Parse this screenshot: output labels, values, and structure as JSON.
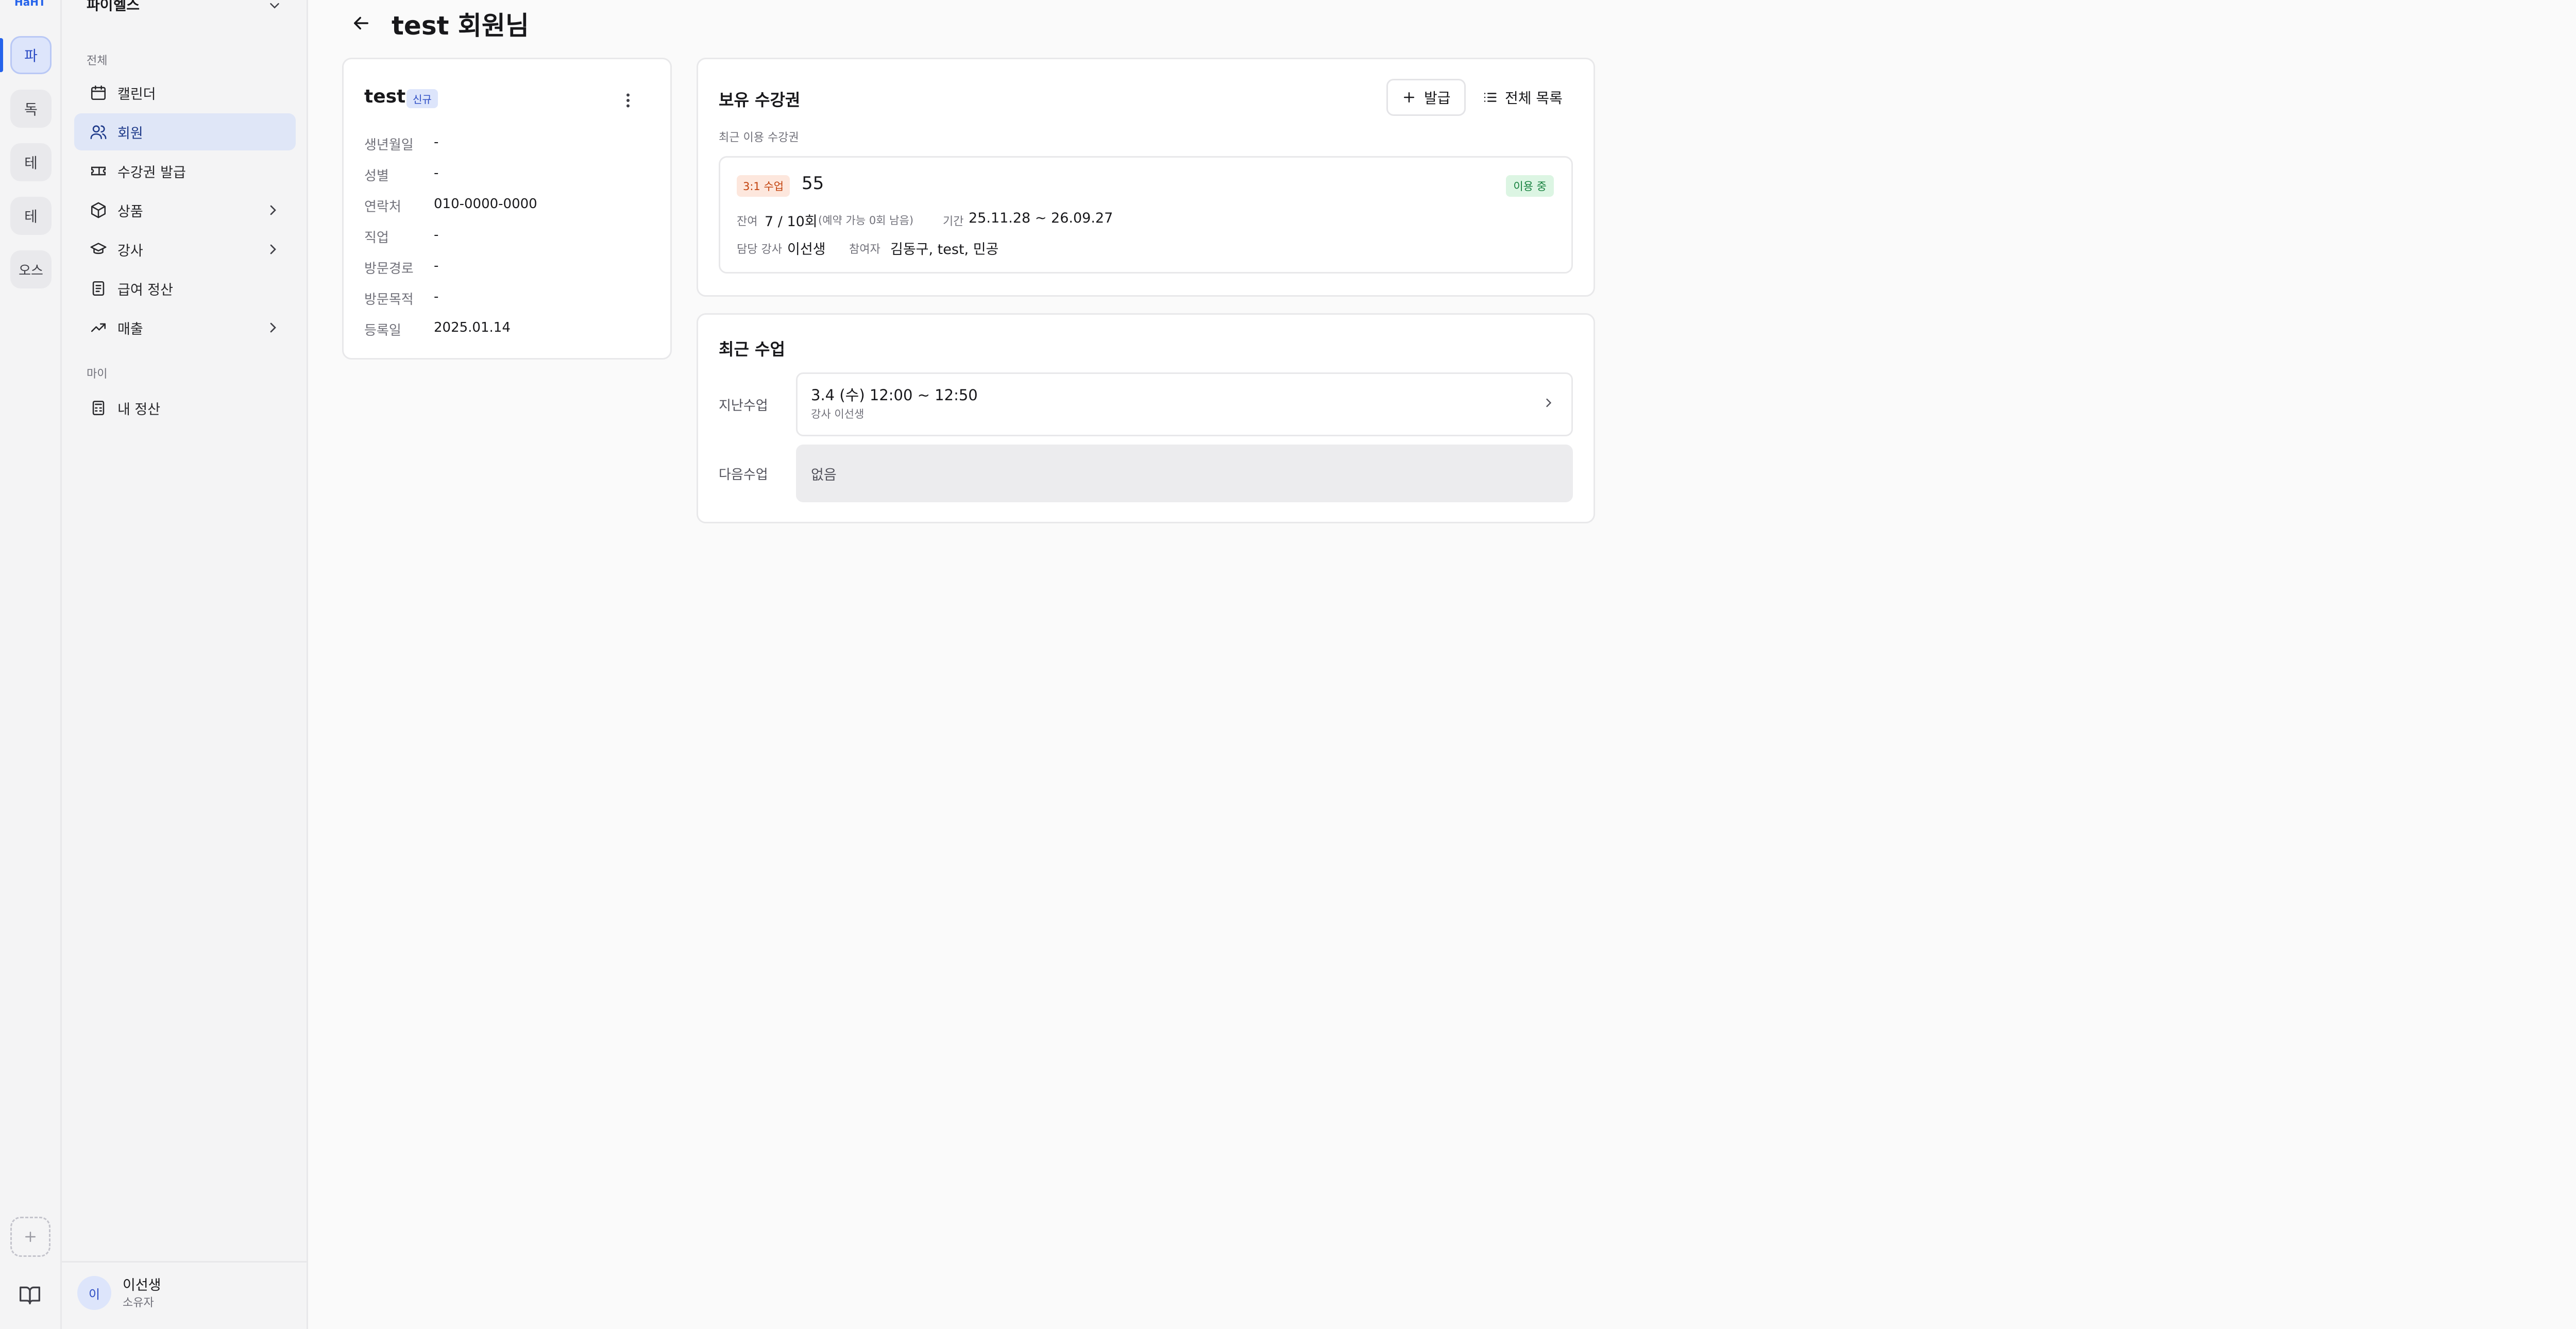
{
  "rail": {
    "logo": "HaHT",
    "items": [
      "파",
      "독",
      "테",
      "테",
      "오스"
    ]
  },
  "sidebar": {
    "workspace": "파이헬스",
    "section_all": "전체",
    "section_my": "마이",
    "items": [
      {
        "label": "캘린더"
      },
      {
        "label": "회원"
      },
      {
        "label": "수강권 발급"
      },
      {
        "label": "상품"
      },
      {
        "label": "강사"
      },
      {
        "label": "급여 정산"
      },
      {
        "label": "매출"
      }
    ],
    "my_items": [
      {
        "label": "내 정산"
      }
    ],
    "user": {
      "initial": "이",
      "name": "이선생",
      "role": "소유자"
    }
  },
  "page": {
    "title": "test 회원님"
  },
  "profile": {
    "name": "test",
    "badge": "신규",
    "fields": [
      {
        "label": "생년월일",
        "value": "-"
      },
      {
        "label": "성별",
        "value": "-"
      },
      {
        "label": "연락처",
        "value": "010-0000-0000"
      },
      {
        "label": "직업",
        "value": "-"
      },
      {
        "label": "방문경로",
        "value": "-"
      },
      {
        "label": "방문목적",
        "value": "-"
      },
      {
        "label": "등록일",
        "value": "2025.01.14"
      }
    ]
  },
  "passes": {
    "title": "보유 수강권",
    "issue_label": "발급",
    "all_label": "전체 목록",
    "recent_label": "최근 이용 수강권",
    "pass": {
      "type": "3:1 수업",
      "name": "55",
      "status": "이용 중",
      "remaining_label": "잔여",
      "remaining_value": "7 / 10회",
      "remaining_note": "(예약 가능 0회 남음)",
      "period_label": "기간",
      "period_value": "25.11.28 ~ 26.09.27",
      "teacher_label": "담당 강사",
      "teacher_value": "이선생",
      "participants_label": "참여자",
      "participants_value": "김동구, test, 민공"
    }
  },
  "lessons": {
    "title": "최근 수업",
    "past_label": "지난수업",
    "past_time": "3.4 (수) 12:00 ~ 12:50",
    "past_teacher": "강사 이선생",
    "next_label": "다음수업",
    "next_value": "없음"
  }
}
